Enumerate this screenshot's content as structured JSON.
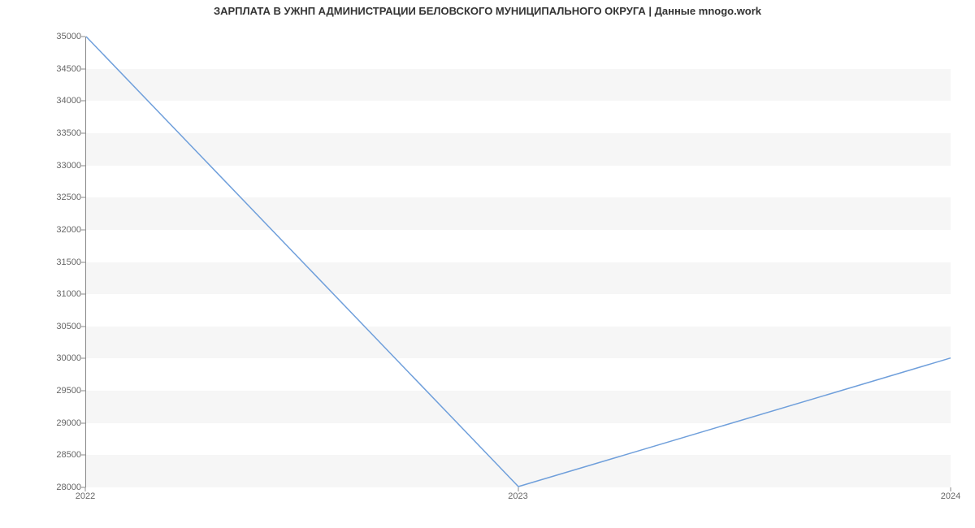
{
  "chart_data": {
    "type": "line",
    "title": "ЗАРПЛАТА В УЖНП АДМИНИСТРАЦИИ БЕЛОВСКОГО МУНИЦИПАЛЬНОГО ОКРУГА | Данные mnogo.work",
    "xlabel": "",
    "ylabel": "",
    "x": [
      "2022",
      "2023",
      "2024"
    ],
    "values": [
      35000,
      28000,
      30000
    ],
    "ylim": [
      28000,
      35000
    ],
    "y_ticks": [
      28000,
      28500,
      29000,
      29500,
      30000,
      30500,
      31000,
      31500,
      32000,
      32500,
      33000,
      33500,
      34000,
      34500,
      35000
    ],
    "line_color": "#6f9fdb",
    "band_color": "#f6f6f6",
    "grid": true
  }
}
